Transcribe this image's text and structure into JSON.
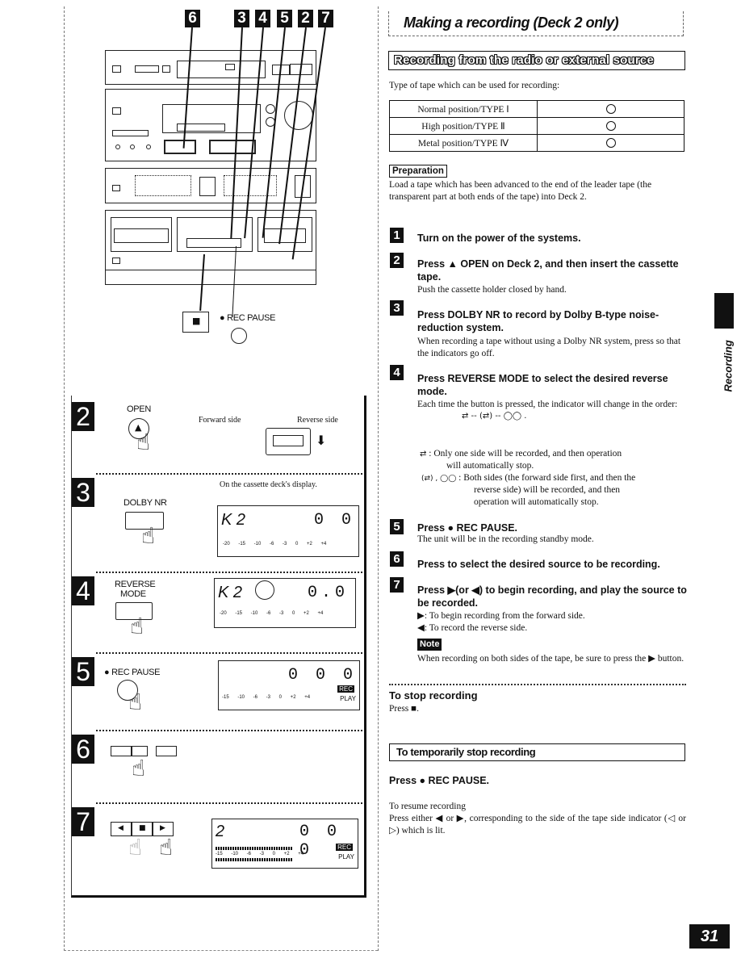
{
  "page": {
    "title": "Making a recording (Deck 2 only)",
    "section_banner": "Recording from the radio or external source",
    "side_tab_label": "Recording",
    "page_number": "31"
  },
  "illustration": {
    "callout_numbers": [
      "6",
      "3",
      "4",
      "5",
      "2",
      "7"
    ],
    "stop_button_glyph": "■",
    "rec_pause_label": "● REC PAUSE"
  },
  "step_panels": [
    {
      "number": "2",
      "button_label": "OPEN",
      "button_glyph": "▲",
      "forward_label": "Forward side",
      "reverse_label": "Reverse side"
    },
    {
      "number": "3",
      "button_label": "DOLBY NR",
      "display_caption": "On the cassette deck's display.",
      "display_left": "K 2",
      "display_right": "0 0",
      "display_scale": "-20 -15 -10 -6 -3 0 +2 +4"
    },
    {
      "number": "4",
      "button_label_line1": "REVERSE",
      "button_label_line2": "MODE",
      "display_left": "K 2",
      "display_right": "0.0",
      "display_scale": "-20 -15 -10 -6 -3 0 +2 +4"
    },
    {
      "number": "5",
      "button_label": "● REC PAUSE",
      "display_right": "0 0 0",
      "display_scale": "-15 -10 -6 -3 0 +2 +4",
      "rec_badge": "REC",
      "play_badge": "PLAY"
    },
    {
      "number": "6"
    },
    {
      "number": "7",
      "transport_buttons": [
        "◀",
        "■",
        "▶"
      ],
      "display_left": "2",
      "display_right": "0 0 0",
      "display_scale": "-15 -10 -6 -3 0 +2 +4",
      "rec_badge": "REC",
      "play_badge": "PLAY"
    }
  ],
  "tape_types": {
    "intro": "Type of tape which can be used for recording:",
    "rows": [
      {
        "type": "Normal position/TYPE Ⅰ",
        "usable": "○"
      },
      {
        "type": "High position/TYPE Ⅱ",
        "usable": "○"
      },
      {
        "type": "Metal position/TYPE Ⅳ",
        "usable": "○"
      }
    ]
  },
  "preparation": {
    "label": "Preparation",
    "text": "Load a tape which has been advanced to the end of the leader tape (the transparent part at both ends of the tape) into Deck 2."
  },
  "steps": [
    {
      "number": "1",
      "heading": "Turn on the power of the systems."
    },
    {
      "number": "2",
      "heading": "Press ▲ OPEN on Deck 2, and then insert the cassette tape.",
      "body": "Push the cassette holder closed by hand."
    },
    {
      "number": "3",
      "heading": "Press DOLBY NR to record by Dolby B-type noise-reduction system.",
      "body": "When recording a tape without using a Dolby NR system, press so that the indicators go off."
    },
    {
      "number": "4",
      "heading": "Press REVERSE MODE to select the desired reverse mode.",
      "body": "Each time the button is pressed, the indicator will change in the order:",
      "order_glyphs": "⇄ -- (⇄) -- ◯◯ ."
    },
    {
      "number": "5",
      "heading": "Press ● REC PAUSE.",
      "body": "The unit will be in the recording standby mode."
    },
    {
      "number": "6",
      "heading": "Press to select the desired source to be recording."
    },
    {
      "number": "7",
      "heading": "Press ▶(or ◀) to begin recording, and play the source to be recorded.",
      "body_forward": "▶: To begin recording from the forward side.",
      "body_reverse": "◀: To record the reverse side."
    }
  ],
  "reverse_mode_notes": {
    "one_side_glyph": "⇄",
    "one_side_line1": ": Only one side will be recorded, and then operation",
    "one_side_line2": "will automatically stop.",
    "both_glyphs": "(⇄) , ◯◯",
    "both_line1": ": Both sides (the forward side first, and then the",
    "both_line2": "reverse side) will be recorded, and then",
    "both_line3": "operation will automatically stop."
  },
  "note": {
    "label": "Note",
    "text": "When recording on both sides of the tape, be sure to press the ▶ button."
  },
  "stop_recording": {
    "heading": "To stop recording",
    "text": "Press ■."
  },
  "temporary_stop": {
    "heading": "To temporarily stop recording",
    "instruction": "Press ● REC PAUSE.",
    "resume_heading": "To resume recording",
    "resume_text": "Press either ◀ or ▶, corresponding to the side of the tape side indicator (◁ or ▷) which is lit."
  }
}
